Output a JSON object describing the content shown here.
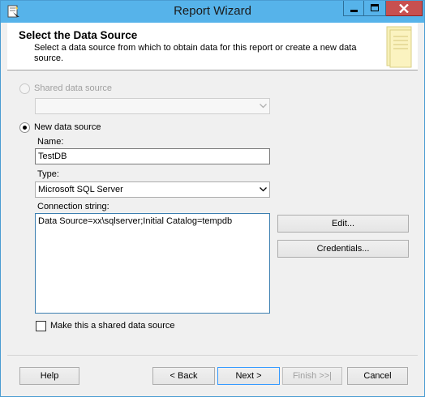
{
  "window": {
    "title": "Report Wizard"
  },
  "header": {
    "title": "Select the Data Source",
    "description": "Select a data source from which to obtain data for this report or create a new data source."
  },
  "shared_source": {
    "label": "Shared data source",
    "selected_value": "",
    "enabled": false
  },
  "new_source": {
    "label": "New data source",
    "selected": true,
    "name_label": "Name:",
    "name_value": "TestDB",
    "type_label": "Type:",
    "type_value": "Microsoft SQL Server",
    "connection_label": "Connection string:",
    "connection_value": "Data Source=xx\\sqlserver;Initial Catalog=tempdb",
    "edit_button": "Edit...",
    "credentials_button": "Credentials...",
    "make_shared_label": "Make this a shared data source",
    "make_shared_checked": false
  },
  "footer": {
    "help": "Help",
    "back": "< Back",
    "next": "Next >",
    "finish": "Finish >>|",
    "cancel": "Cancel"
  },
  "colors": {
    "titlebar": "#56b3ea",
    "close_button": "#c75050",
    "dialog_bg": "#f0f0f0"
  }
}
